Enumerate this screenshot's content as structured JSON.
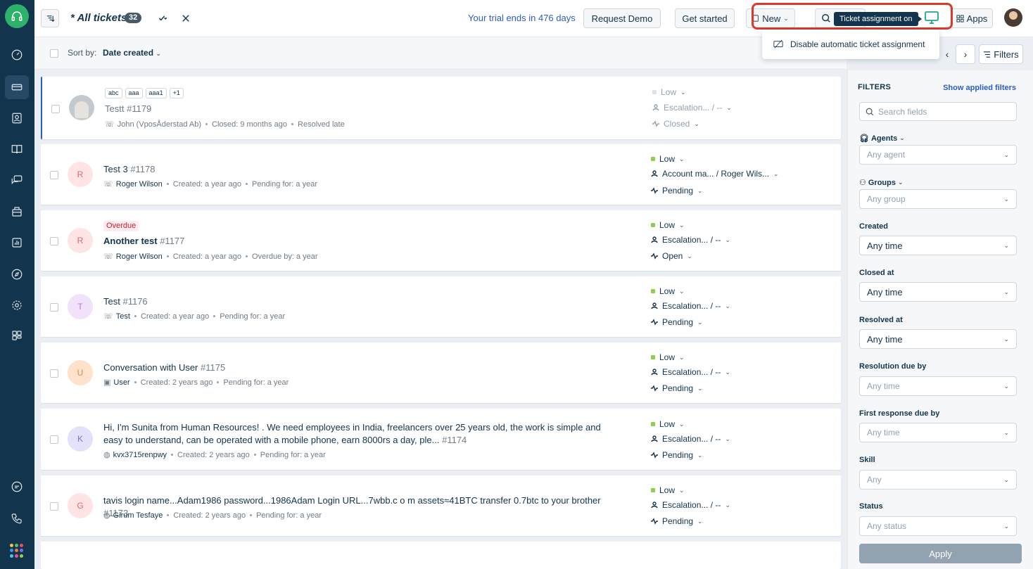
{
  "topbar": {
    "title": "* All tickets",
    "count": "32",
    "trial": "Your trial ends in 476 days",
    "request_demo": "Request Demo",
    "get_started": "Get started",
    "new_label": "New",
    "tooltip": "Ticket assignment on",
    "apps_label": "Apps"
  },
  "sortbar": {
    "sort_label": "Sort by:",
    "sort_value": "Date created"
  },
  "dropdown": {
    "item": "Disable automatic ticket assignment"
  },
  "toolbar_right": {
    "filters_label": "Filters"
  },
  "tickets": [
    {
      "tags": [
        "abc",
        "aaa",
        "aaa1",
        "+1"
      ],
      "subject": "Testt",
      "number": "#1179",
      "requester": "John (VposÅderstad Ab)",
      "meta1": "Closed: 9 months ago",
      "meta2": "Resolved late",
      "priority": "Low",
      "group": "Escalation... / --",
      "status": "Closed",
      "avatar_letter": ""
    },
    {
      "subject": "Test 3",
      "number": "#1178",
      "requester": "Roger Wilson",
      "meta1": "Created: a year ago",
      "meta2": "Pending for: a year",
      "priority": "Low",
      "group": "Account ma... / Roger Wils...",
      "status": "Pending",
      "avatar_letter": "R"
    },
    {
      "badge": "Overdue",
      "subject": "Another test",
      "number": "#1177",
      "requester": "Roger Wilson",
      "meta1": "Created: a year ago",
      "meta2": "Overdue by: a year",
      "priority": "Low",
      "group": "Escalation... / --",
      "status": "Open",
      "avatar_letter": "R"
    },
    {
      "subject": "Test",
      "number": "#1176",
      "requester": "Test",
      "meta1": "Created: a year ago",
      "meta2": "Pending for: a year",
      "priority": "Low",
      "group": "Escalation... / --",
      "status": "Pending",
      "avatar_letter": "T"
    },
    {
      "subject": "Conversation with User",
      "number": "#1175",
      "requester": "User",
      "meta1": "Created: 2 years ago",
      "meta2": "Pending for: a year",
      "priority": "Low",
      "group": "Escalation... / --",
      "status": "Pending",
      "avatar_letter": "U"
    },
    {
      "subject": "Hi, I'm Sunita from Human Resources! . We need employees in India, freelancers over 25 years old, the work is simple and easy to understand, can be operated with a mobile phone, earn 8000rs a day, ple...",
      "number": "#1174",
      "requester": "kvx3715renpwy",
      "meta1": "Created: 2 years ago",
      "meta2": "Pending for: a year",
      "priority": "Low",
      "group": "Escalation... / --",
      "status": "Pending",
      "avatar_letter": "K"
    },
    {
      "subject": "tavis login name...Adam1986 password...1986Adam Login URL...7wbb.c o m assets≈41BTC transfer 0.7btc to your brother",
      "number": "#1173",
      "requester": "Girum Tesfaye",
      "meta1": "Created: 2 years ago",
      "meta2": "Pending for: a year",
      "priority": "Low",
      "group": "Escalation... / --",
      "status": "Pending",
      "avatar_letter": "G"
    }
  ],
  "filters": {
    "heading": "FILTERS",
    "show_applied": "Show applied filters",
    "search_placeholder": "Search fields",
    "agents_label": "Agents",
    "agents_value": "Any agent",
    "groups_label": "Groups",
    "groups_value": "Any group",
    "created_label": "Created",
    "created_value": "Any time",
    "closed_label": "Closed at",
    "closed_value": "Any time",
    "resolved_label": "Resolved at",
    "resolved_value": "Any time",
    "resolution_due_label": "Resolution due by",
    "resolution_due_value": "Any time",
    "first_response_label": "First response due by",
    "first_response_value": "Any time",
    "skill_label": "Skill",
    "skill_value": "Any",
    "status_label": "Status",
    "status_value": "Any status",
    "apply": "Apply"
  },
  "colors": {
    "brand_green": "#2cb26b",
    "link_blue": "#2c5cc5",
    "priority_low": "#8ad24e",
    "highlight_red": "#d93a2b",
    "assignment_icon": "#1ca88e"
  }
}
